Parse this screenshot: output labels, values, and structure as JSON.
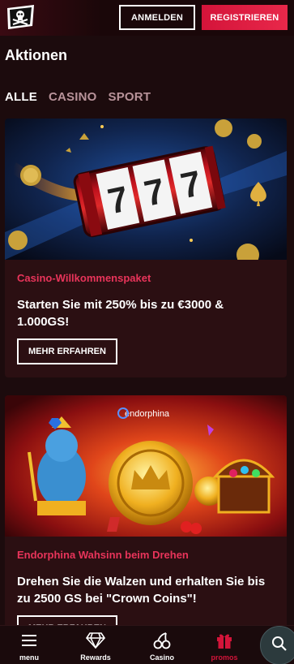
{
  "header": {
    "login_label": "ANMELDEN",
    "register_label": "REGISTRIEREN"
  },
  "page": {
    "title": "Aktionen"
  },
  "tabs": [
    {
      "label": "ALLE",
      "active": true
    },
    {
      "label": "CASINO",
      "active": false
    },
    {
      "label": "SPORT",
      "active": false
    }
  ],
  "promotions": [
    {
      "tag": "Casino-Willkommenspaket",
      "headline": "Starten Sie mit 250% bis zu €3000 & 1.000GS!",
      "button_label": "MEHR ERFAHREN",
      "image_text": "777"
    },
    {
      "tag": "Endorphina Wahsinn beim Drehen",
      "headline": "Drehen Sie die Walzen und erhalten Sie bis zu 2500 GS bei \"Crown Coins\"!",
      "button_label": "MEHR ERFAHREN",
      "image_text": "endorphina"
    }
  ],
  "bottom_nav": [
    {
      "label": "menu",
      "icon": "hamburger-icon",
      "active": false
    },
    {
      "label": "Rewards",
      "icon": "diamond-icon",
      "active": false
    },
    {
      "label": "Casino",
      "icon": "cherry-icon",
      "active": false
    },
    {
      "label": "promos",
      "icon": "gift-icon",
      "active": true
    }
  ],
  "colors": {
    "accent": "#d4143a",
    "background": "#1c0b0d",
    "card": "#2b0f12",
    "tag": "#e8345a"
  }
}
